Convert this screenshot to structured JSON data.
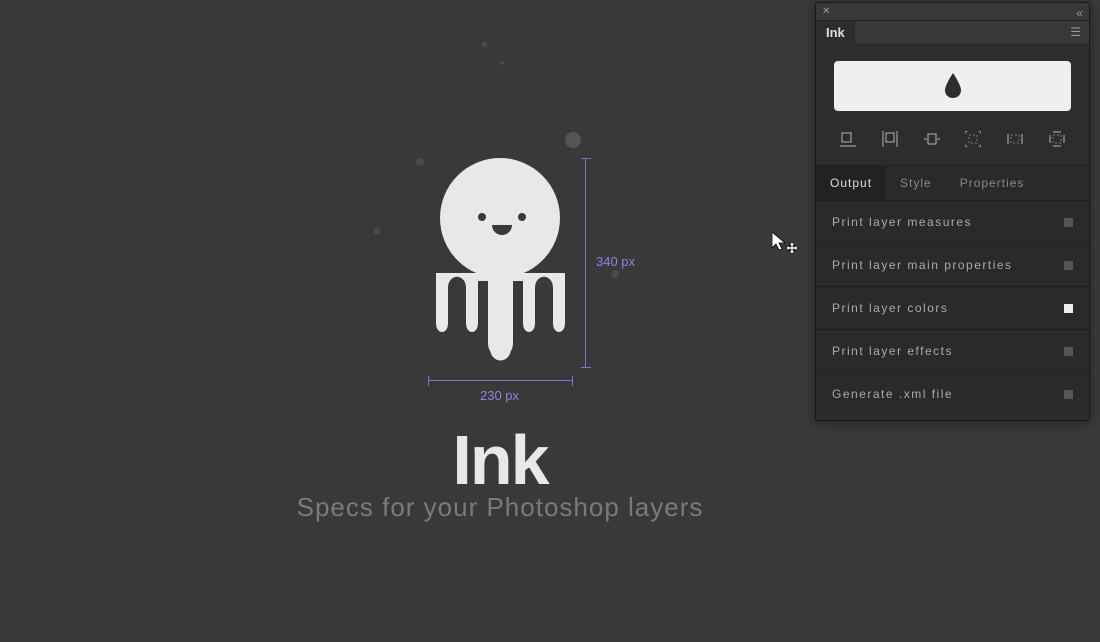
{
  "canvas": {
    "measure_height": "340 px",
    "measure_width": "230 px",
    "title": "Ink",
    "subtitle": "Specs for your Photoshop layers"
  },
  "panel": {
    "tab_name": "Ink",
    "section_tabs": [
      "Output",
      "Style",
      "Properties"
    ],
    "active_section_tab": 0,
    "options": [
      {
        "label": "Print layer measures",
        "checked": false
      },
      {
        "label": "Print layer main properties",
        "checked": false
      },
      {
        "label": "Print layer colors",
        "checked": true
      },
      {
        "label": "Print layer effects",
        "checked": false
      },
      {
        "label": "Generate .xml file",
        "checked": false
      }
    ]
  }
}
